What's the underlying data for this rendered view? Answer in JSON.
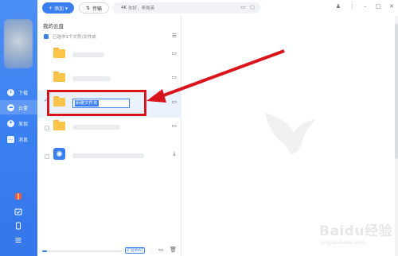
{
  "topbar": {
    "add_label": "添加",
    "transfer_label": "传输",
    "search_badge": "4K",
    "search_placeholder": "你好，李焕英"
  },
  "sidebar": {
    "items": [
      {
        "label": "下载",
        "icon": "download-icon"
      },
      {
        "label": "云盘",
        "icon": "cloud-icon"
      },
      {
        "label": "发现",
        "icon": "compass-icon"
      },
      {
        "label": "消息",
        "icon": "message-icon"
      }
    ],
    "bottom_icons": [
      "gift-icon",
      "calendar-check-icon",
      "phone-icon",
      "menu-icon"
    ]
  },
  "panel": {
    "breadcrumb": "我的云盘",
    "selection_text": "已选中1个文件/文件夹",
    "rename_value": "新建文件夹",
    "expand_label": "扩容到6T",
    "storage_fill_fraction": 0.06
  },
  "colors": {
    "accent": "#3a7ff0",
    "folder": "#fcc54a",
    "highlight": "#d9141b"
  },
  "watermark": {
    "text": "Baidu经验",
    "subtext": "jingyan.baidu.com"
  }
}
